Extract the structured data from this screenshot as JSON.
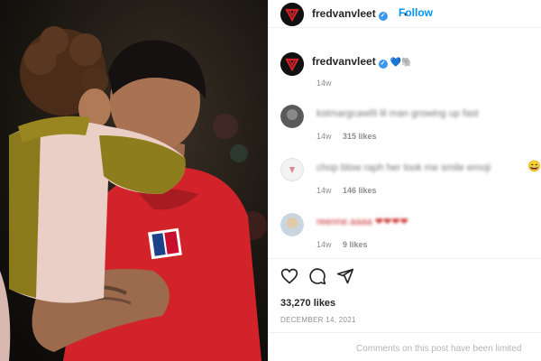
{
  "header": {
    "username": "fredvanvleet",
    "separator": "•",
    "follow_label": "Follow"
  },
  "caption": {
    "username": "fredvanvleet",
    "emojis": "💙🐘",
    "time": "14w"
  },
  "comments": [
    {
      "text": "kstmargcawl9 lil man growing up fast",
      "time": "14w",
      "likes": "315 likes",
      "avatar_color": "#5a5a5a"
    },
    {
      "text": "chop blow raph her look me smile emoji",
      "time": "14w",
      "likes": "146 likes",
      "avatar_color": "#f3f3f3"
    },
    {
      "text": "reenne.aaaa ❤❤❤❤",
      "time": "14w",
      "likes": "9 likes",
      "avatar_color": "#c9d6df"
    }
  ],
  "actions": {
    "like": "heart-icon",
    "comment": "comment-icon",
    "share": "share-icon"
  },
  "post": {
    "likes": "33,270 likes",
    "date": "DECEMBER 14, 2021",
    "limited_notice": "Comments on this post have been limited"
  },
  "colors": {
    "accent": "#0095f6",
    "verified": "#3897f0",
    "jersey": "#d2232a"
  }
}
